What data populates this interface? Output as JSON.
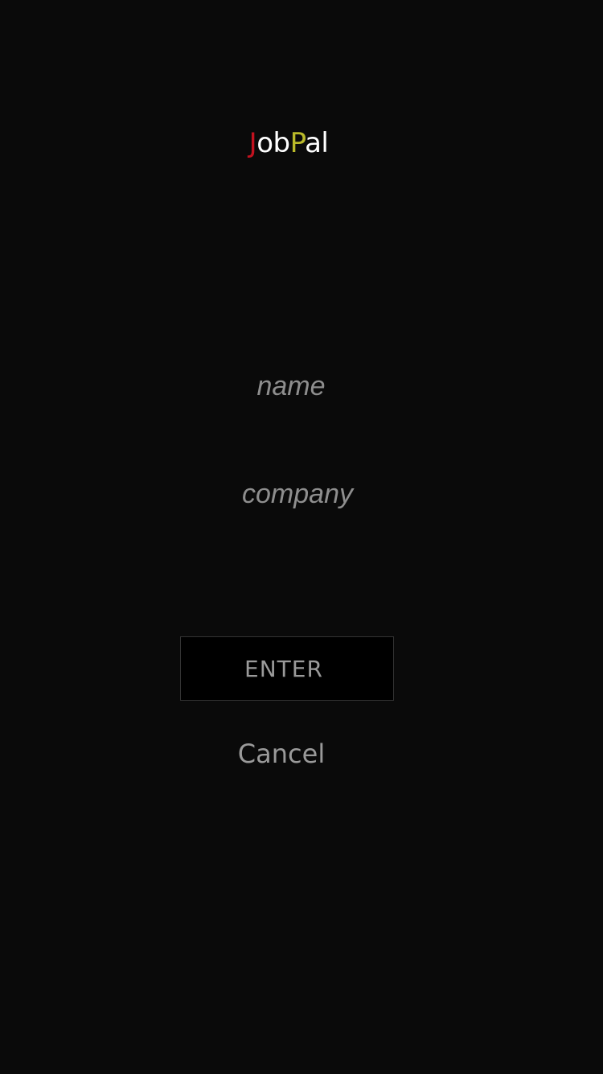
{
  "app": {
    "logo": {
      "parts": [
        "J",
        "ob",
        "P",
        "al"
      ],
      "colors": [
        "#c2121f",
        "#ffffff",
        "#b9b92a",
        "#ffffff"
      ]
    }
  },
  "form": {
    "name_placeholder": "name",
    "company_placeholder": "company",
    "name_value": "",
    "company_value": ""
  },
  "actions": {
    "enter_label": "ENTER",
    "cancel_label": "Cancel"
  }
}
